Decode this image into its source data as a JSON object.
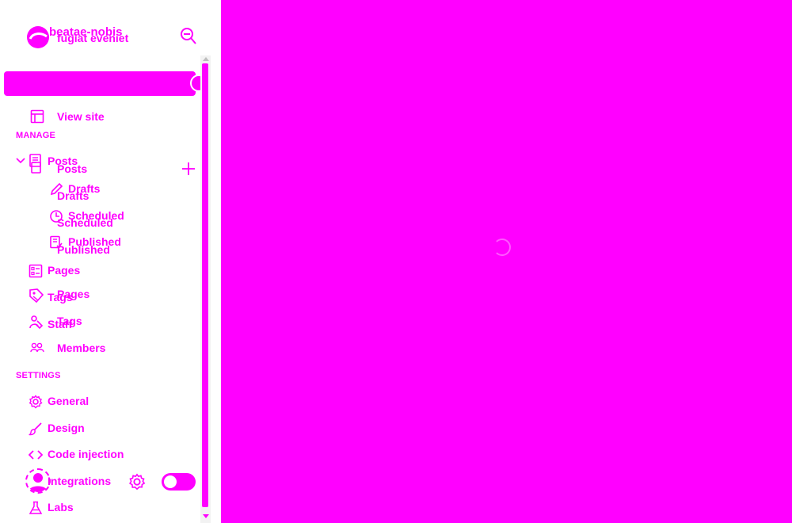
{
  "brand": {
    "site_title": "beatae-nobis",
    "site_title_overlay": "fugiat eveniet"
  },
  "search": {
    "placeholder": ""
  },
  "nav": {
    "view_site": "View site",
    "manage_heading": "MANAGE",
    "posts": "Posts",
    "posts_overlay": "Posts",
    "drafts": "Drafts",
    "drafts_overlay": "Drafts",
    "scheduled": "Scheduled",
    "scheduled_overlay": "Scheduled",
    "published": "Published",
    "published_overlay": "Published",
    "pages": "Pages",
    "pages_overlay": "Pages",
    "tags": "Tags",
    "tags_overlay": "Tags",
    "staff": "Staff",
    "members": "Members",
    "settings_heading": "SETTINGS",
    "general": "General",
    "design": "Design",
    "code_injection": "Code injection",
    "integrations": "Integrations",
    "labs": "Labs"
  },
  "icons": {
    "logo": "logo-icon",
    "search": "search-icon",
    "view_site": "layout-icon",
    "collapse": "chevron-down-icon",
    "posts": "document-icon",
    "new_post": "plus-icon",
    "drafts": "pencil-icon",
    "scheduled": "clock-icon",
    "published": "published-document-icon",
    "pages": "pages-icon",
    "tags": "tag-icon",
    "staff": "staff-icon",
    "members": "members-icon",
    "general": "gear-icon",
    "design": "brush-icon",
    "code_injection": "code-icon",
    "integrations": "integrations-icon",
    "labs": "flask-icon",
    "settings": "gear-icon",
    "loading": "spinner-icon"
  },
  "footer": {
    "night_shift_on": false
  },
  "colors": {
    "accent": "#ff00ff",
    "sidebar_bg": "#ffffff",
    "scrollbar_track": "#f2f2f2"
  }
}
